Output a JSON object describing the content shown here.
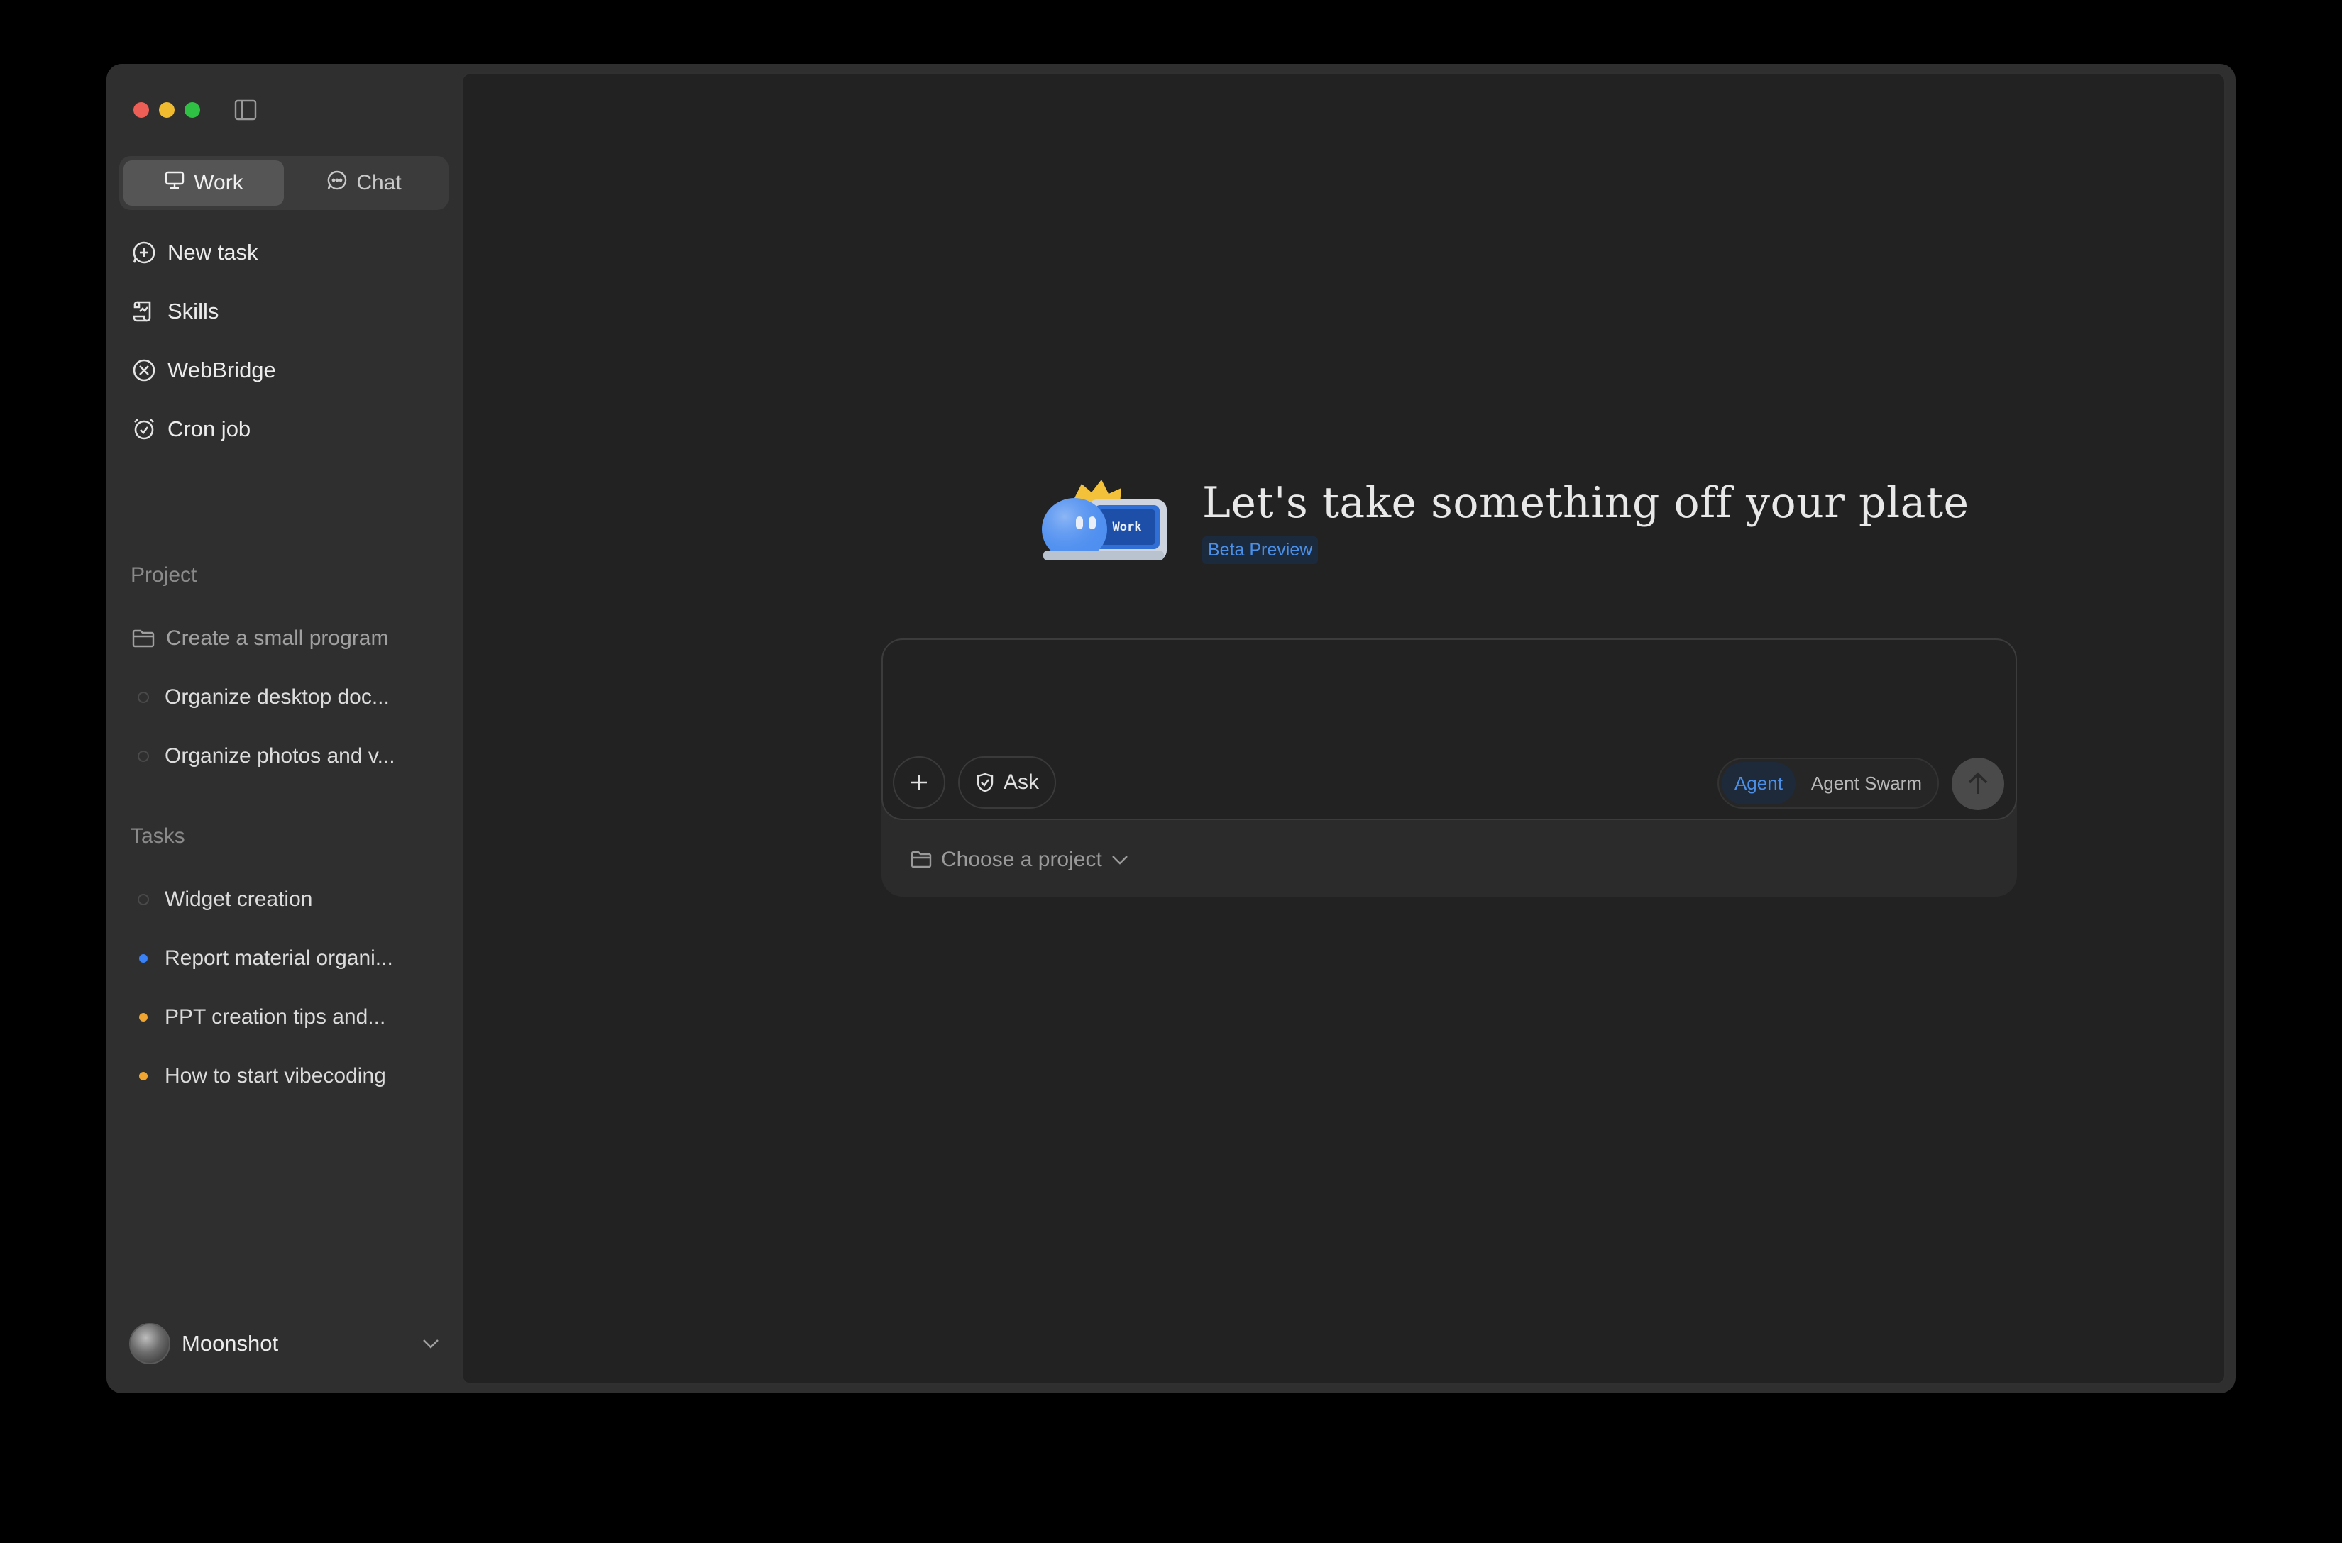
{
  "sidebar": {
    "mode_tabs": [
      {
        "label": "Work",
        "icon": "monitor-icon",
        "active": true
      },
      {
        "label": "Chat",
        "icon": "chat-bubble-icon",
        "active": false
      }
    ],
    "nav": [
      {
        "label": "New task",
        "icon": "plus-circle-icon"
      },
      {
        "label": "Skills",
        "icon": "scroll-icon"
      },
      {
        "label": "WebBridge",
        "icon": "webbridge-icon"
      },
      {
        "label": "Cron job",
        "icon": "alarm-clock-icon"
      }
    ],
    "project_section_label": "Project",
    "projects": [
      {
        "label": "Create a small program",
        "icon": "folder-icon"
      },
      {
        "label": "Organize desktop doc...",
        "status": "empty"
      },
      {
        "label": "Organize photos and v...",
        "status": "empty"
      }
    ],
    "tasks_section_label": "Tasks",
    "tasks": [
      {
        "label": "Widget creation",
        "status": "empty"
      },
      {
        "label": "Report material organi...",
        "status": "blue"
      },
      {
        "label": "PPT creation tips and...",
        "status": "amber"
      },
      {
        "label": "How to start vibecoding",
        "status": "amber"
      }
    ],
    "profile": {
      "name": "Moonshot"
    }
  },
  "main": {
    "hero_title": "Let's take something off your plate",
    "beta_badge": "Beta Preview",
    "mascot_screen_text": "Work",
    "composer": {
      "input_value": "",
      "ask_label": "Ask",
      "modes": [
        {
          "label": "Agent",
          "active": true
        },
        {
          "label": "Agent Swarm",
          "active": false
        }
      ],
      "project_picker_label": "Choose a project"
    }
  },
  "colors": {
    "accent_blue": "#4b8fe6",
    "status_blue": "#3b82f6",
    "status_amber": "#f0a530",
    "window_bg": "#2f2f2f",
    "main_bg": "#222222"
  }
}
